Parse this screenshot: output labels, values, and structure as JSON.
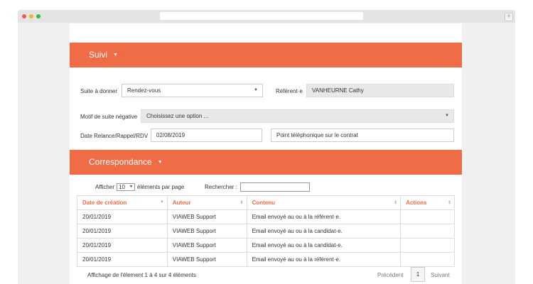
{
  "colors": {
    "accent": "#ef6c47",
    "dot_red": "#ee5b4f",
    "dot_yellow": "#f2b232",
    "dot_green": "#2fbf3f"
  },
  "suivi": {
    "title": "Suivi",
    "suite_label": "Suite à donner",
    "suite_value": "Rendez-vous",
    "referent_label": "Référent·e",
    "referent_value": "VANHEURNE Cathy",
    "motif_label": "Motif de suite négative",
    "motif_placeholder": "Choisissez une option ...",
    "date_label": "Date Relance/Rappel/RDV",
    "date_value": "02/08/2019",
    "note_value": "Point téléphonique sur le contrat"
  },
  "correspondance": {
    "title": "Correspondance",
    "show_label": "Afficher",
    "page_size": "10",
    "per_page_label": "éléments par page",
    "search_label": "Rechercher :",
    "columns": [
      "Date de création",
      "Auteur",
      "Contenu",
      "Actions"
    ],
    "rows": [
      [
        "20/01/2019",
        "VIAWEB Support",
        "Email envoyé au ou à la référent·e.",
        ""
      ],
      [
        "20/01/2019",
        "VIAWEB Support",
        "Email envoyé au ou à la candidat·e.",
        ""
      ],
      [
        "20/01/2019",
        "VIAWEB Support",
        "Email envoyé au ou à la candidat·e.",
        ""
      ],
      [
        "20/01/2019",
        "VIAWEB Support",
        "Email envoyé au ou à la référent·e.",
        ""
      ]
    ],
    "info": "Affichage de l'élement 1 à 4 sur 4 éléments",
    "prev_label": "Précédent",
    "current_page": "1",
    "next_label": "Suivant"
  }
}
